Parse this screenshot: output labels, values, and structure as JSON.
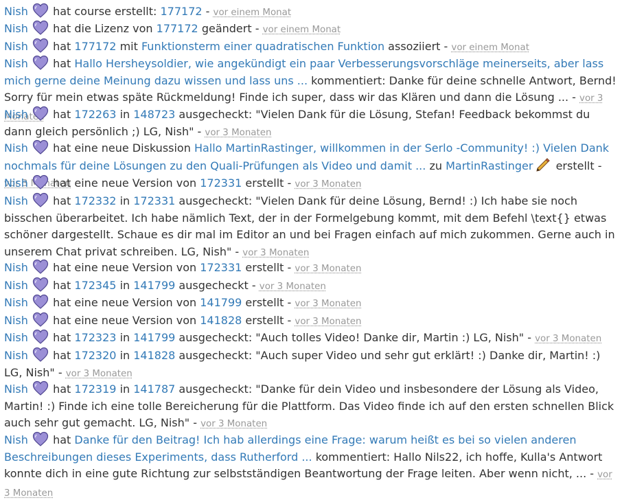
{
  "user": "Nish",
  "other_user": "MartinRastinger",
  "sep": "-",
  "icons": {
    "user_avatar": "purple-heart-icon",
    "other_avatar": "pencil-icon"
  },
  "colors": {
    "link": "#337ab7",
    "text": "#333333",
    "time": "#999999",
    "heart": "#9b8fd6",
    "pencil": "#d9534f"
  },
  "entries": [
    {
      "id": "e1",
      "action": "hat course erstellt:",
      "link1": "177172",
      "time": "vor einem Monat"
    },
    {
      "id": "e2",
      "pre": "hat die Lizenz von",
      "link1": "177172",
      "post": "geändert",
      "time": "vor einem Monat"
    },
    {
      "id": "e3",
      "pre": "hat",
      "link1": "177172",
      "mid": "mit",
      "link2": "Funktionsterm einer quadratischen Funktion",
      "post": "assoziiert",
      "time": "vor einem Monat"
    },
    {
      "id": "e4",
      "pre": "hat",
      "link1": "Hallo Hersheysoldier, wie angekündigt ein paar Verbesserungsvorschläge meinerseits, aber lass mich gerne deine Meinung dazu wissen und lass uns ...",
      "post": "kommentiert: Danke für deine schnelle Antwort, Bernd! Sorry für mein etwas späte Rückmeldung! Finde ich super, dass wir das Klären und dann die Lösung ...",
      "time": "vor 3 Monaten"
    },
    {
      "id": "e5",
      "pre": "hat",
      "link1": "172263",
      "mid": "in",
      "link2": "148723",
      "post": "ausgecheckt: \"Vielen Dank für die Lösung, Stefan! Feedback bekommst du dann gleich persönlich ;) LG, Nish\"",
      "time": "vor 3 Monaten"
    },
    {
      "id": "e6",
      "pre": "hat eine neue Diskussion",
      "link1": "Hallo MartinRastinger, willkommen in der Serlo -Community! :) Vielen Dank nochmals für deine Lösungen zu den Quali-Prüfungen als Video und damit ...",
      "mid": "zu",
      "post": "erstellt",
      "time": "vor 3 Monaten"
    },
    {
      "id": "e7",
      "pre": "hat eine neue Version von",
      "link1": "172331",
      "post": "erstellt",
      "time": "vor 3 Monaten"
    },
    {
      "id": "e8",
      "pre": "hat",
      "link1": "172332",
      "mid": "in",
      "link2": "172331",
      "post": "ausgecheckt: \"Vielen Dank für deine Lösung, Bernd! :) Ich habe sie noch bisschen überarbeitet. Ich habe nämlich Text, der in der Formelgebung kommt, mit dem Befehl \\text{} etwas schöner dargestellt. Schaue es dir mal im Editor an und bei Fragen einfach auf mich zukommen. Gerne auch in unserem Chat privat schreiben. LG, Nish\"",
      "time": "vor 3 Monaten"
    },
    {
      "id": "e9",
      "pre": "hat eine neue Version von",
      "link1": "172331",
      "post": "erstellt",
      "time": "vor 3 Monaten"
    },
    {
      "id": "e10",
      "pre": "hat",
      "link1": "172345",
      "mid": "in",
      "link2": "141799",
      "post": "ausgecheckt",
      "time": "vor 3 Monaten"
    },
    {
      "id": "e11",
      "pre": "hat eine neue Version von",
      "link1": "141799",
      "post": "erstellt",
      "time": "vor 3 Monaten"
    },
    {
      "id": "e12",
      "pre": "hat eine neue Version von",
      "link1": "141828",
      "post": "erstellt",
      "time": "vor 3 Monaten"
    },
    {
      "id": "e13",
      "pre": "hat",
      "link1": "172323",
      "mid": "in",
      "link2": "141799",
      "post": "ausgecheckt: \"Auch tolles Video! Danke dir, Martin :) LG, Nish\"",
      "time": "vor 3 Monaten"
    },
    {
      "id": "e14",
      "pre": "hat",
      "link1": "172320",
      "mid": "in",
      "link2": "141828",
      "post": "ausgecheckt: \"Auch super Video und sehr gut erklärt! :) Danke dir, Martin! :) LG, Nish\"",
      "time": "vor 3 Monaten"
    },
    {
      "id": "e15",
      "pre": "hat",
      "link1": "172319",
      "mid": "in",
      "link2": "141787",
      "post": "ausgecheckt: \"Danke für dein Video und insbesondere der Lösung als Video, Martin! :) Finde ich eine tolle Bereicherung für die Plattform. Das Video finde ich auf den ersten schnellen Blick auch sehr gut gemacht. LG, Nish\"",
      "time": "vor 3 Monaten"
    },
    {
      "id": "e16",
      "pre": "hat",
      "link1": "Danke für den Beitrag! Ich hab allerdings eine Frage: warum heißt es bei so vielen anderen Beschreibungen dieses Experiments, dass Rutherford ...",
      "post": "kommentiert: Hallo Nils22, ich hoffe, Kulla's Antwort konnte dich in eine gute Richtung zur selbstständigen Beantwortung der Frage leiten. Aber wenn nicht, ...",
      "time": "vor 3 Monaten"
    }
  ]
}
